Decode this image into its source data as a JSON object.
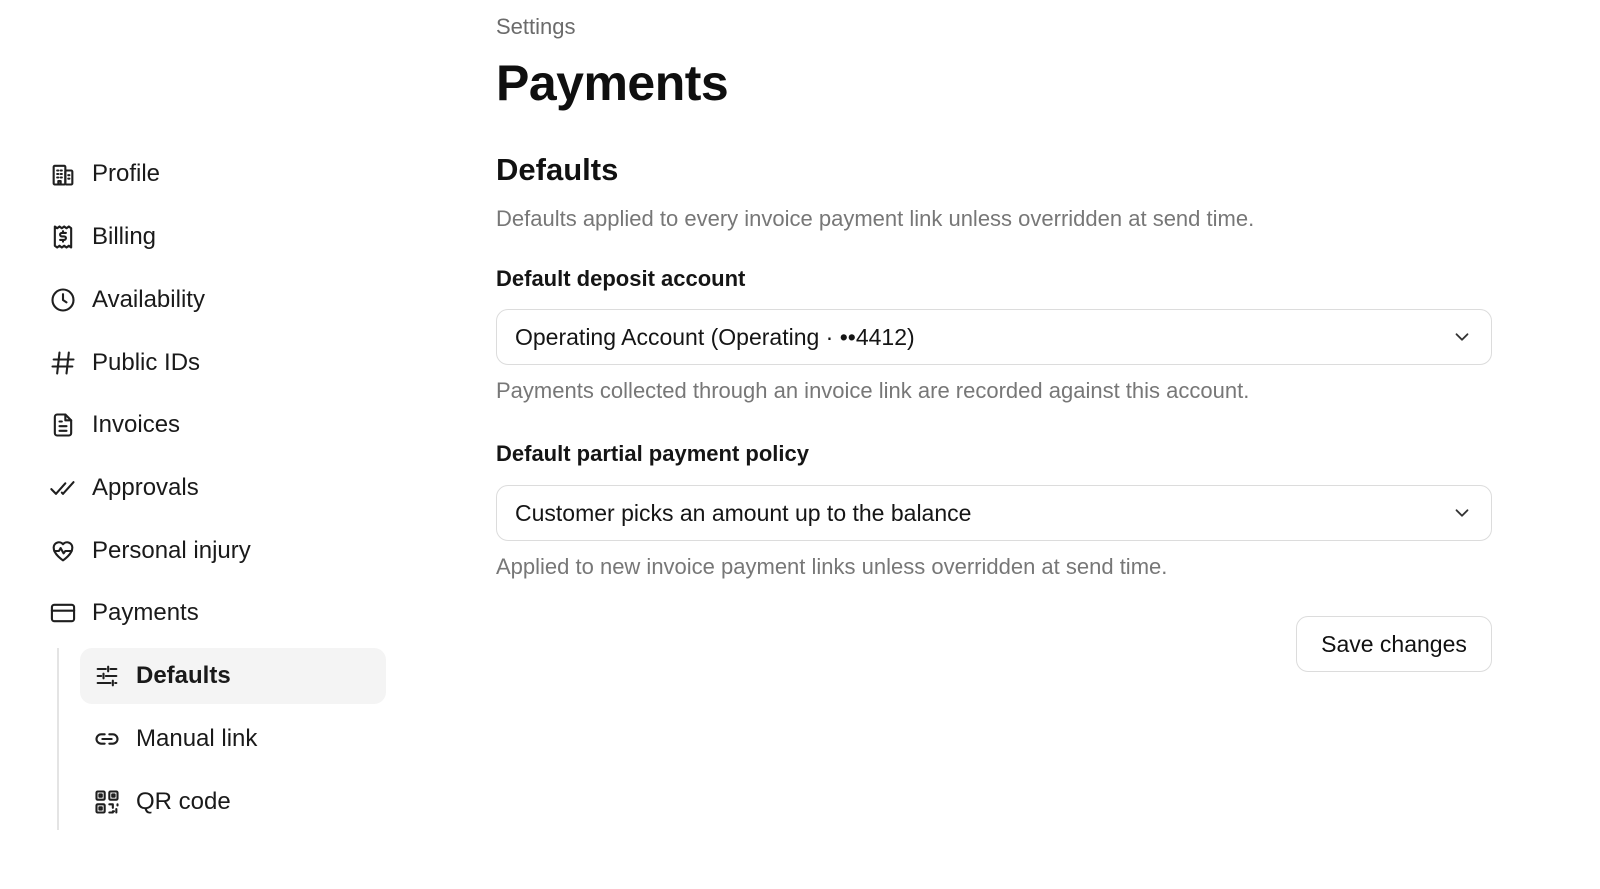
{
  "sidebar": {
    "items": [
      {
        "label": "Profile",
        "icon": "building-icon"
      },
      {
        "label": "Billing",
        "icon": "receipt-dollar-icon"
      },
      {
        "label": "Availability",
        "icon": "clock-icon"
      },
      {
        "label": "Public IDs",
        "icon": "hash-icon"
      },
      {
        "label": "Invoices",
        "icon": "document-icon"
      },
      {
        "label": "Approvals",
        "icon": "double-check-icon"
      },
      {
        "label": "Personal injury",
        "icon": "heart-pulse-icon"
      },
      {
        "label": "Payments",
        "icon": "credit-card-icon"
      }
    ],
    "subitems": [
      {
        "label": "Defaults",
        "icon": "sliders-icon",
        "active": true
      },
      {
        "label": "Manual link",
        "icon": "link-icon",
        "active": false
      },
      {
        "label": "QR code",
        "icon": "qr-code-icon",
        "active": false
      }
    ]
  },
  "main": {
    "breadcrumb": "Settings",
    "title": "Payments",
    "section": {
      "title": "Defaults",
      "description": "Defaults applied to every invoice payment link unless overridden at send time."
    },
    "deposit_account": {
      "label": "Default deposit account",
      "value": "Operating Account (Operating · ••4412)",
      "hint": "Payments collected through an invoice link are recorded against this account."
    },
    "partial_policy": {
      "label": "Default partial payment policy",
      "value": "Customer picks an amount up to the balance",
      "hint": "Applied to new invoice payment links unless overridden at send time."
    },
    "save_label": "Save changes"
  }
}
